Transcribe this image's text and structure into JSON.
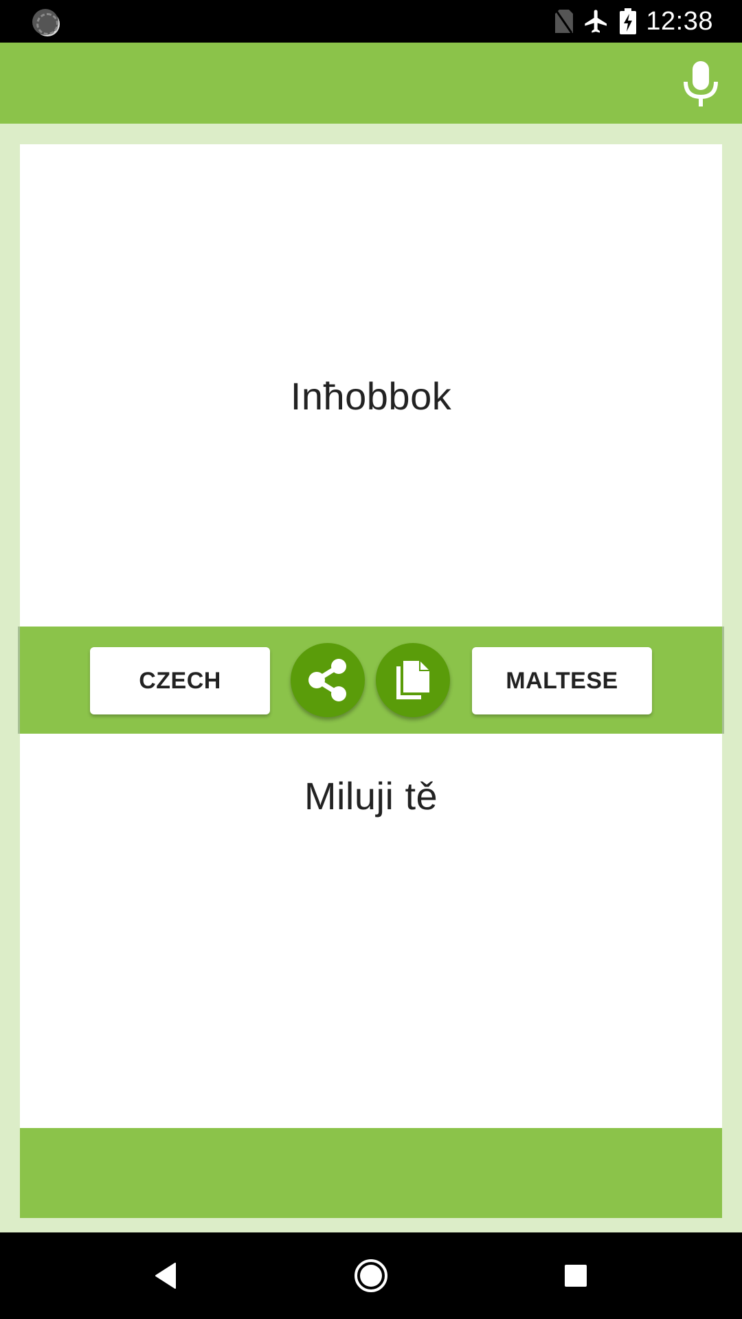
{
  "status_bar": {
    "time": "12:38",
    "icons": [
      "loading-icon",
      "no-sim-icon",
      "airplane-mode-icon",
      "battery-charging-icon"
    ]
  },
  "app_bar": {
    "mic_icon": "microphone-icon"
  },
  "translation": {
    "source_text": "Inħobbok",
    "target_text": "Miluji tě"
  },
  "controls": {
    "left_language": "CZECH",
    "right_language": "MALTESE",
    "share_icon": "share-icon",
    "copy_icon": "copy-icon"
  },
  "colors": {
    "primary": "#8bc34a",
    "primary_dark": "#5a9c0a",
    "background": "#dcedc8"
  },
  "nav_bar": {
    "buttons": [
      "back",
      "home",
      "recents"
    ]
  }
}
